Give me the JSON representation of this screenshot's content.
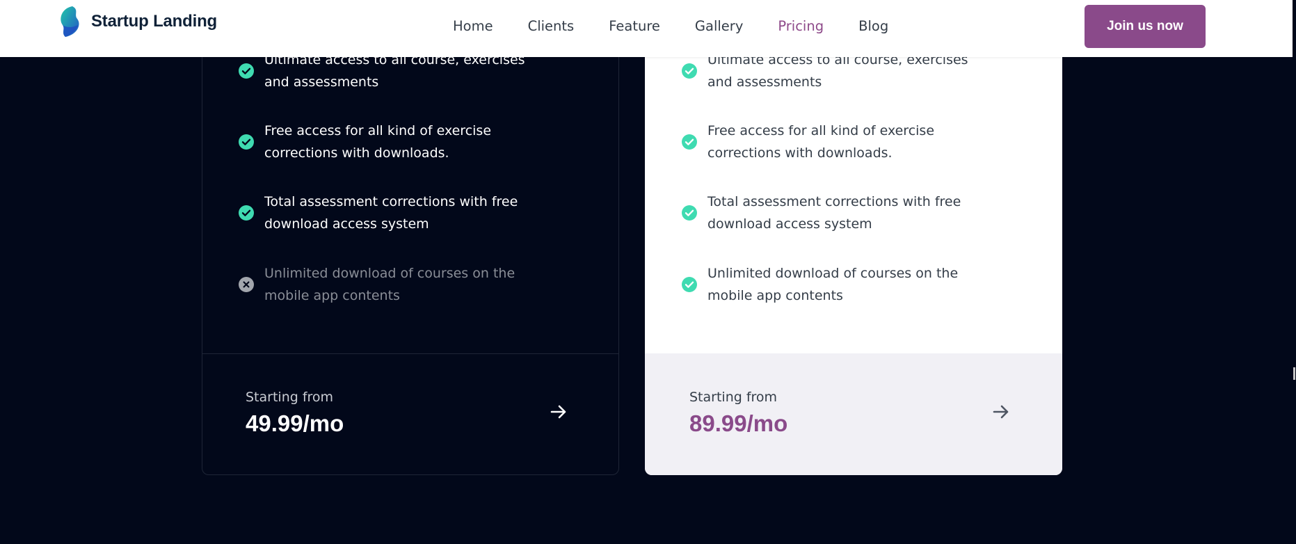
{
  "header": {
    "brand_name": "Startup Landing",
    "nav": [
      "Home",
      "Clients",
      "Feature",
      "Gallery",
      "Pricing",
      "Blog"
    ],
    "active_nav": "Pricing",
    "cta_label": "Join us now",
    "accent_color": "#8a4a8a"
  },
  "plans": {
    "basic": {
      "features": [
        {
          "text": "Ultimate access to all course, exercises and assessments",
          "included": true
        },
        {
          "text": "Free access for all kind of exercise corrections with downloads.",
          "included": true
        },
        {
          "text": "Total assessment corrections with free download access system",
          "included": true
        },
        {
          "text": "Unlimited download of courses on the mobile app contents",
          "included": false
        }
      ],
      "from_label": "Starting from",
      "price": "49.99/mo"
    },
    "pro": {
      "features": [
        {
          "text": "Ultimate access to all course, exercises and assessments",
          "included": true
        },
        {
          "text": "Free access for all kind of exercise corrections with downloads.",
          "included": true
        },
        {
          "text": "Total assessment corrections with free download access system",
          "included": true
        },
        {
          "text": "Unlimited download of courses on the mobile app contents",
          "included": true
        }
      ],
      "from_label": "Starting from",
      "price": "89.99/mo"
    }
  },
  "colors": {
    "page_bg": "#02081a",
    "check_green": "#3fdbb1",
    "price_purple": "#8a4a8a"
  },
  "icons": {
    "included": "check-circle-icon",
    "excluded": "x-circle-icon",
    "cta_arrow": "arrow-right-icon"
  }
}
